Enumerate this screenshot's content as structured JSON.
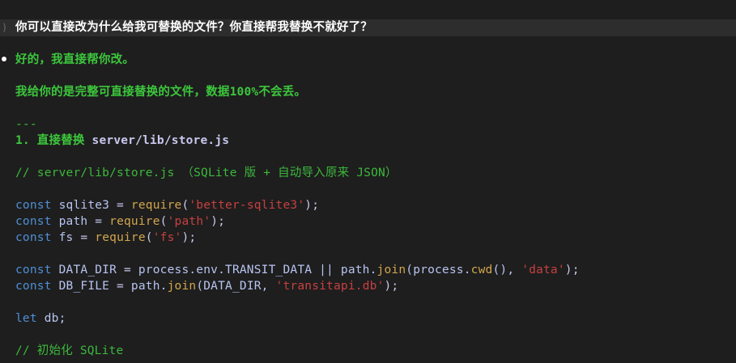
{
  "prompt": {
    "chevron": ")",
    "text": "你可以直接改为什么给我可替换的文件？你直接帮我替换不就好了？"
  },
  "response": {
    "line1": "好的，我直接帮你改。",
    "line2_a": "我给你的是",
    "line2_b": "完整可直接替换的文件",
    "line2_c": "，数据100%不会丢。",
    "hr": "---",
    "heading_prefix": "1. 直接替换",
    "heading_path": "server/lib/store.js"
  },
  "code": {
    "comment1": "// server/lib/store.js （SQLite 版 + 自动导入原来 JSON）",
    "l1": {
      "kw": "const",
      "name": "sqlite3",
      "eq": "=",
      "fn": "require",
      "open": "(",
      "str": "'better-sqlite3'",
      "close": ");"
    },
    "l2": {
      "kw": "const",
      "name": "path",
      "eq": "=",
      "fn": "require",
      "open": "(",
      "str": "'path'",
      "close": ");"
    },
    "l3": {
      "kw": "const",
      "name": "fs",
      "eq": "=",
      "fn": "require",
      "open": "(",
      "str": "'fs'",
      "close": ");"
    },
    "l4": {
      "kw": "const",
      "name": "DATA_DIR",
      "eq": "=",
      "expr1": "process.env.TRANSIT_DATA || path.",
      "fn1": "join",
      "expr2": "(process.",
      "fn2": "cwd",
      "expr3": "(), ",
      "str": "'data'",
      "close": ");"
    },
    "l5": {
      "kw": "const",
      "name": "DB_FILE",
      "eq": "=",
      "expr1": "path.",
      "fn1": "join",
      "expr2": "(DATA_DIR, ",
      "str": "'transitapi.db'",
      "close": ");"
    },
    "l6": {
      "kw": "let",
      "name": "db;"
    },
    "comment2": "// 初始化 SQLite"
  }
}
